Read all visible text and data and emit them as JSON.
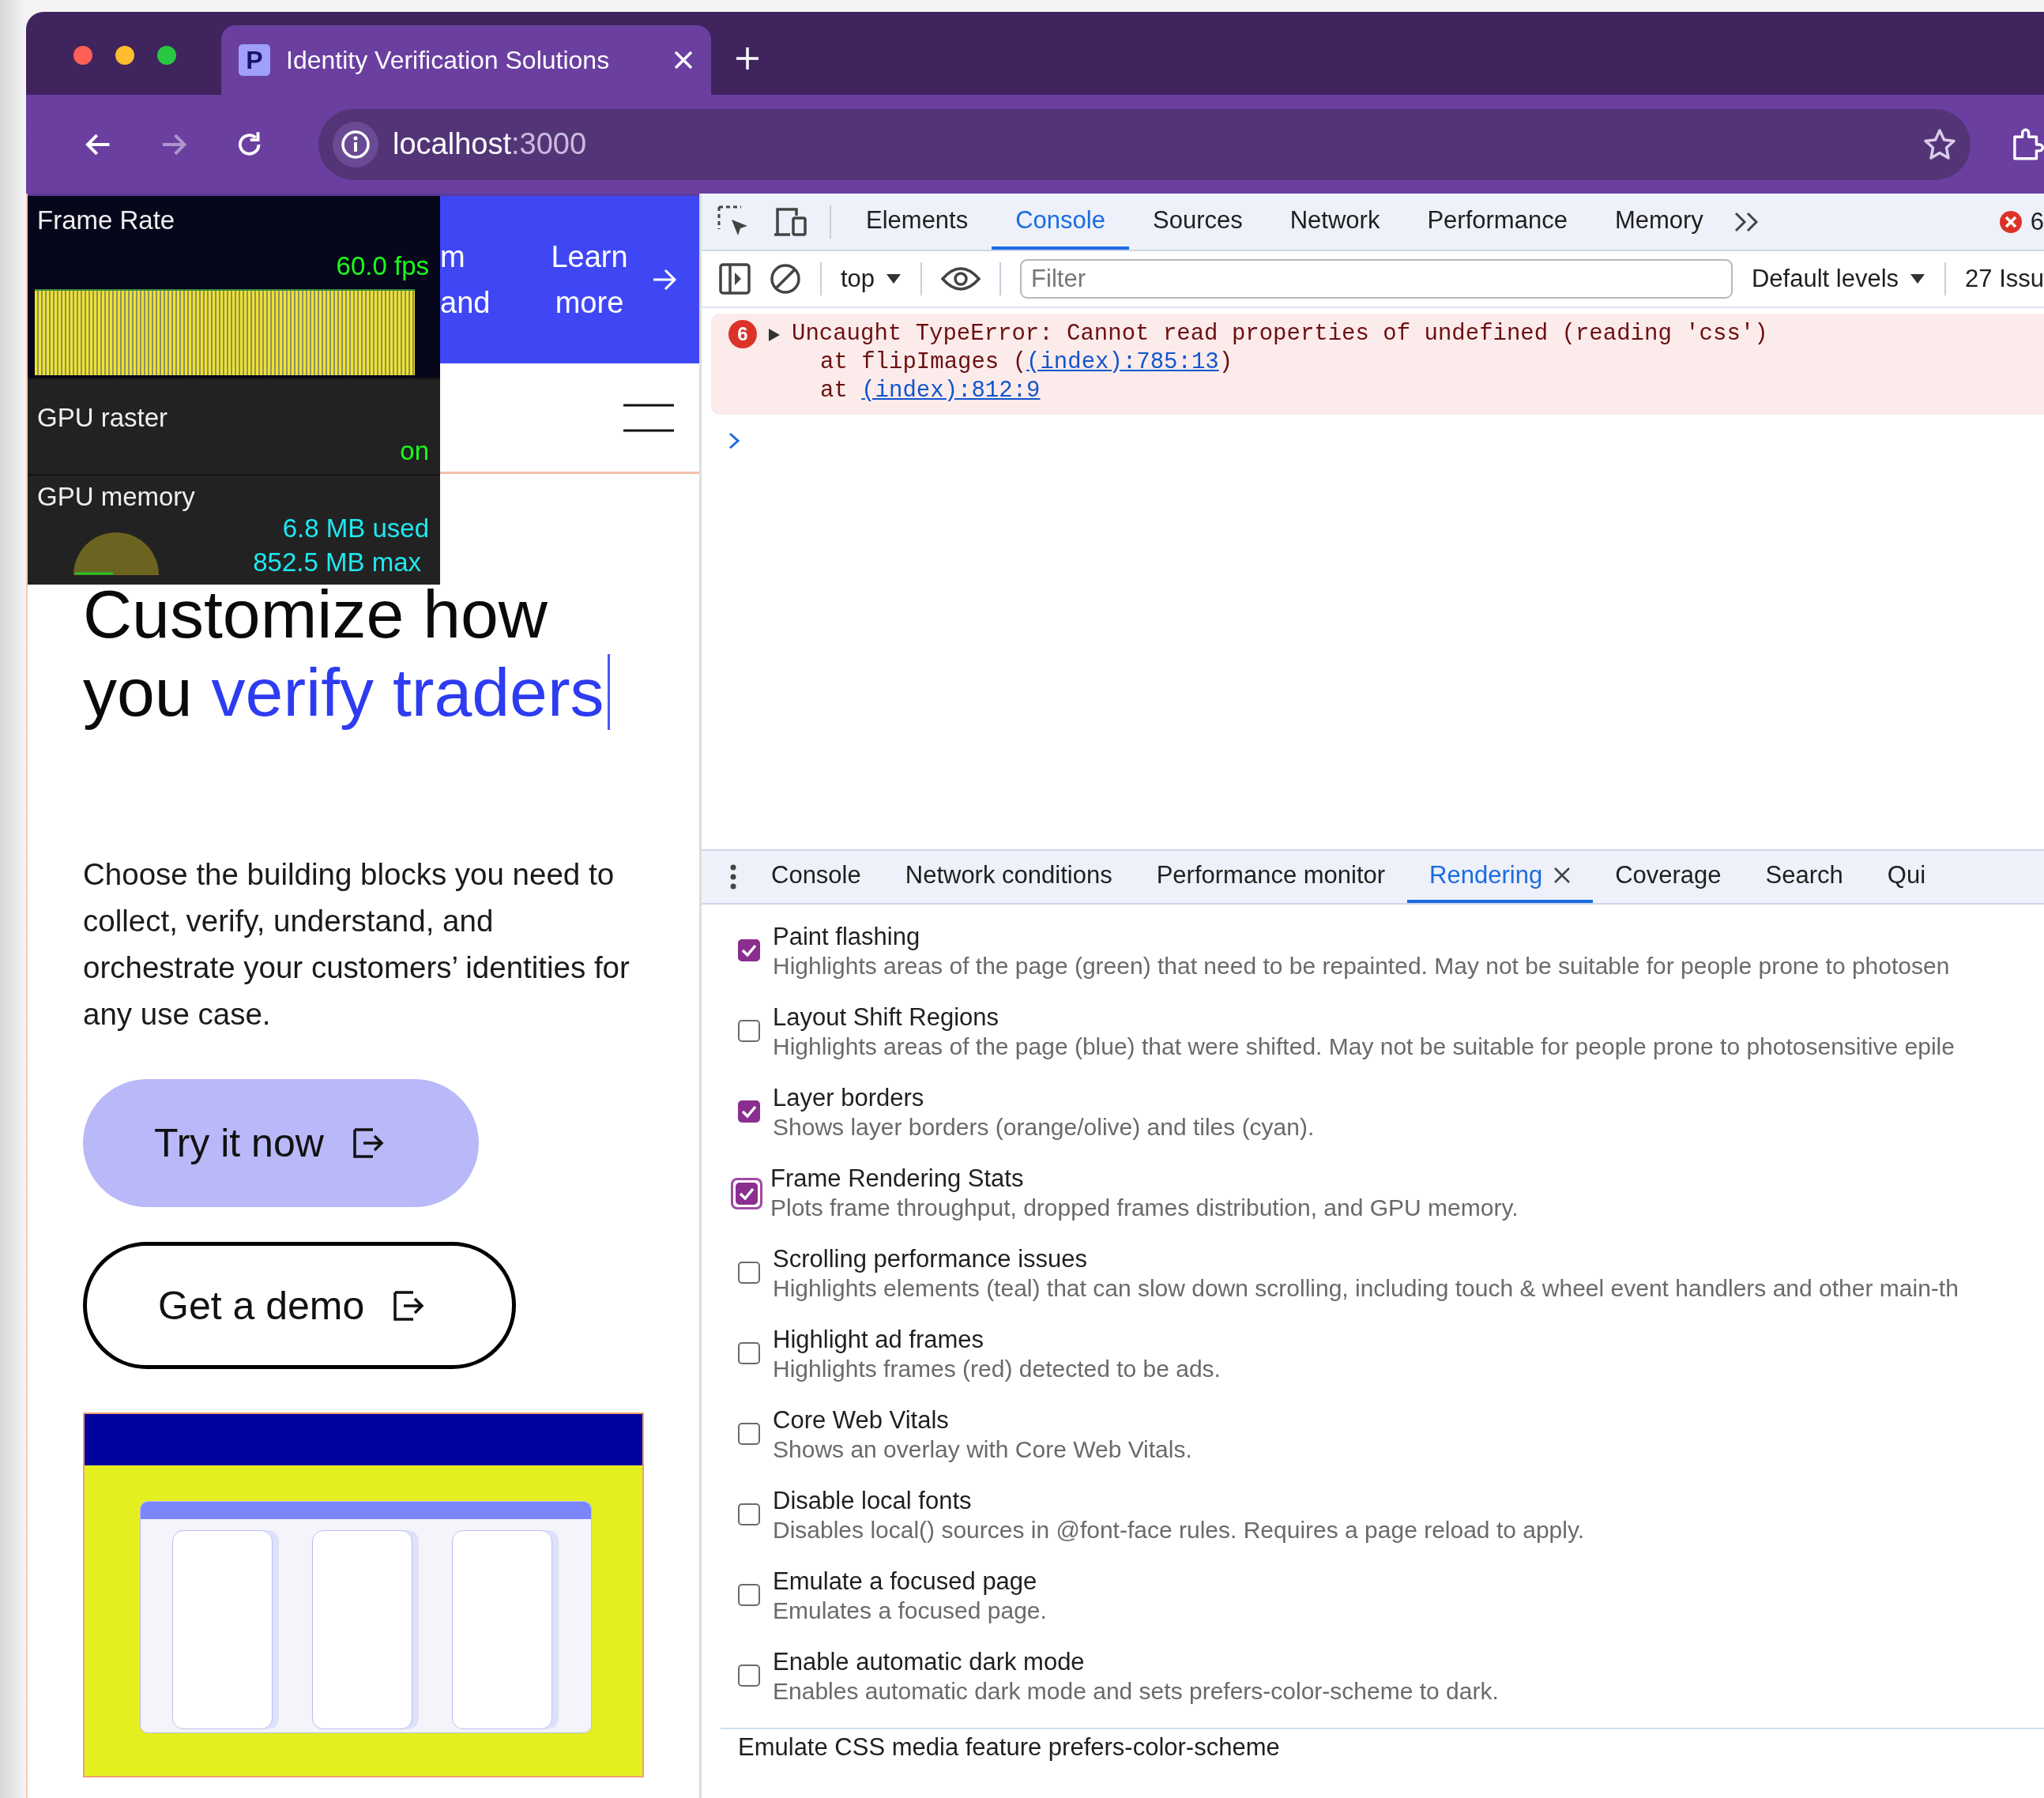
{
  "browser": {
    "tab": {
      "favicon": "P",
      "title": "Identity Verification Solutions"
    },
    "forward_enabled": false,
    "address": {
      "host": "localhost",
      "port": ":3000"
    }
  },
  "page": {
    "banner": {
      "lines": [
        "m",
        "and"
      ],
      "link": "Learn more"
    },
    "heading": {
      "line_1": "Customize how",
      "line_2": "you",
      "accent": "verify traders"
    },
    "paragraph": "Choose the building blocks you need to collect, verify, understand, and orchestrate your customers’ identities for any use case.",
    "buttons": [
      {
        "label": "Try it now",
        "kind": "filled"
      },
      {
        "label": "Get a demo",
        "kind": "outline"
      }
    ]
  },
  "overlay": {
    "frame_rate": {
      "label": "Frame Rate",
      "value": "60.0 fps"
    },
    "gpu_raster": {
      "label": "GPU raster",
      "value": "on"
    },
    "gpu_memory": {
      "label": "GPU memory",
      "used": "6.8 MB used",
      "max": "852.5 MB max"
    }
  },
  "devtools": {
    "tabs": [
      {
        "label": "Elements",
        "selected": false
      },
      {
        "label": "Console",
        "selected": true
      },
      {
        "label": "Sources",
        "selected": false
      },
      {
        "label": "Network",
        "selected": false
      },
      {
        "label": "Performance",
        "selected": false
      },
      {
        "label": "Memory",
        "selected": false
      }
    ],
    "error_count": "6",
    "console_toolbar": {
      "context": "top",
      "filter_placeholder": "Filter",
      "levels": "Default levels",
      "issues": "27 Issu"
    },
    "messages": [
      {
        "count": "6",
        "text": "Uncaught TypeError: Cannot read properties of undefined (reading 'css')",
        "stack": [
          {
            "prefix": "at flipImages (",
            "link": "(index):785:13",
            "suffix": ")"
          },
          {
            "prefix": "at ",
            "link": "(index):812:9"
          }
        ]
      }
    ],
    "drawer_tabs": [
      {
        "label": "Console",
        "selected": false
      },
      {
        "label": "Network conditions",
        "selected": false
      },
      {
        "label": "Performance monitor",
        "selected": false
      },
      {
        "label": "Rendering",
        "selected": true
      },
      {
        "label": "Coverage",
        "selected": false
      },
      {
        "label": "Search",
        "selected": false
      },
      {
        "label": "Qui",
        "selected": false
      }
    ],
    "rendering_options": [
      {
        "title": "Paint flashing",
        "description": "Highlights areas of the page (green) that need to be repainted. May not be suitable for people prone to photosen",
        "checked": true,
        "focused": false
      },
      {
        "title": "Layout Shift Regions",
        "description": "Highlights areas of the page (blue) that were shifted. May not be suitable for people prone to photosensitive epile",
        "checked": false,
        "focused": false
      },
      {
        "title": "Layer borders",
        "description": "Shows layer borders (orange/olive) and tiles (cyan).",
        "checked": true,
        "focused": false
      },
      {
        "title": "Frame Rendering Stats",
        "description": "Plots frame throughput, dropped frames distribution, and GPU memory.",
        "checked": true,
        "focused": true
      },
      {
        "title": "Scrolling performance issues",
        "description": "Highlights elements (teal) that can slow down scrolling, including touch & wheel event handlers and other main-th",
        "checked": false,
        "focused": false
      },
      {
        "title": "Highlight ad frames",
        "description": "Highlights frames (red) detected to be ads.",
        "checked": false,
        "focused": false
      },
      {
        "title": "Core Web Vitals",
        "description": "Shows an overlay with Core Web Vitals.",
        "checked": false,
        "focused": false
      },
      {
        "title": "Disable local fonts",
        "description": "Disables local() sources in @font-face rules. Requires a page reload to apply.",
        "checked": false,
        "focused": false
      },
      {
        "title": "Emulate a focused page",
        "description": "Emulates a focused page.",
        "checked": false,
        "focused": false
      },
      {
        "title": "Enable automatic dark mode",
        "description": "Enables automatic dark mode and sets prefers-color-scheme to dark.",
        "checked": false,
        "focused": false
      }
    ],
    "section_heading": "Emulate CSS media feature prefers-color-scheme"
  }
}
